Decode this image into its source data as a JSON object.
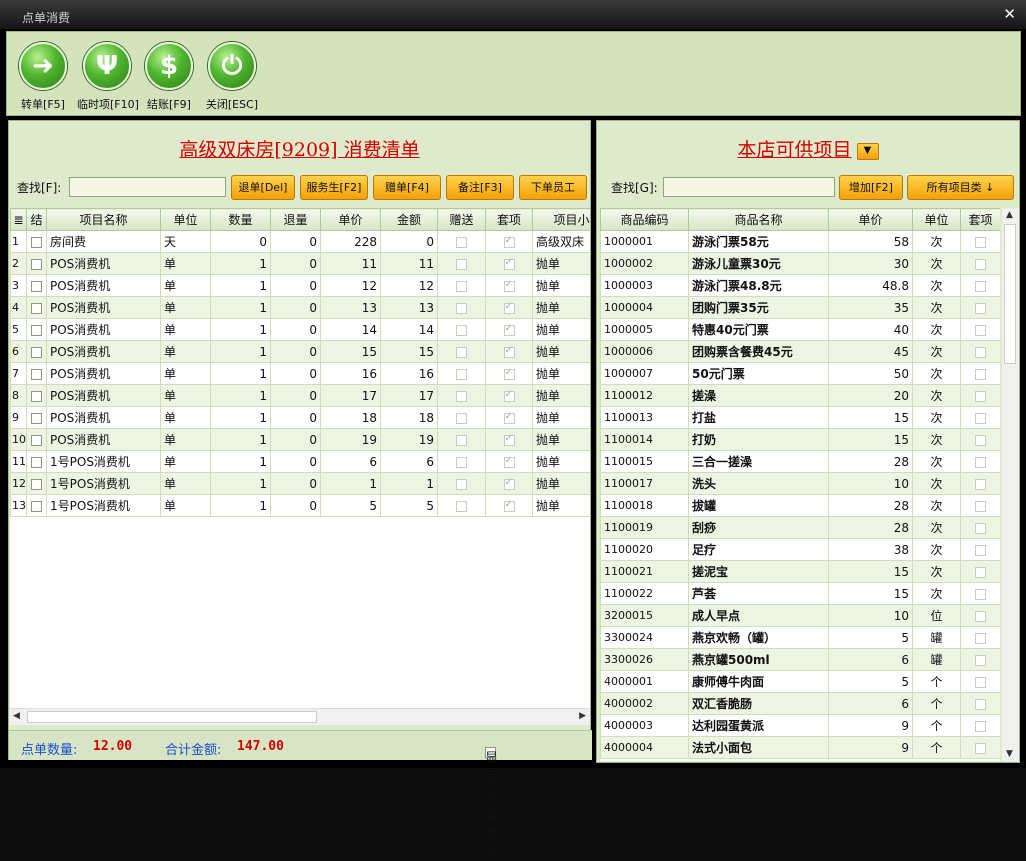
{
  "window": {
    "title": "点单消费",
    "close_icon": "close-icon"
  },
  "toolbar": {
    "buttons": [
      {
        "label": "转单[F5]",
        "icon": "transfer-arrow-icon",
        "glyph": "➜"
      },
      {
        "label": "临时项[F10]",
        "icon": "fork-knife-icon",
        "glyph": "Ψ"
      },
      {
        "label": "结账[F9]",
        "icon": "dollar-icon",
        "glyph": "$"
      },
      {
        "label": "关闭[ESC]",
        "icon": "power-icon",
        "glyph": "⏻"
      }
    ]
  },
  "left": {
    "title": "高级双床房[9209] 消费清单",
    "search_label": "查找[F]:",
    "search_value": "",
    "buttons": [
      "退单[Del]",
      "服务生[F2]",
      "赠单[F4]",
      "备注[F3]",
      "下单员工"
    ],
    "columns": [
      "结",
      "项目名称",
      "单位",
      "数量",
      "退量",
      "单价",
      "金额",
      "赠送",
      "套项",
      "项目小"
    ],
    "rows": [
      {
        "n": "1",
        "name": "房间费",
        "unit": "天",
        "qty": "0",
        "ret": "0",
        "price": "228",
        "amt": "0",
        "group": "高级双床"
      },
      {
        "n": "2",
        "name": "POS消费机",
        "unit": "单",
        "qty": "1",
        "ret": "0",
        "price": "11",
        "amt": "11",
        "group": "抛单"
      },
      {
        "n": "3",
        "name": "POS消费机",
        "unit": "单",
        "qty": "1",
        "ret": "0",
        "price": "12",
        "amt": "12",
        "group": "抛单"
      },
      {
        "n": "4",
        "name": "POS消费机",
        "unit": "单",
        "qty": "1",
        "ret": "0",
        "price": "13",
        "amt": "13",
        "group": "抛单"
      },
      {
        "n": "5",
        "name": "POS消费机",
        "unit": "单",
        "qty": "1",
        "ret": "0",
        "price": "14",
        "amt": "14",
        "group": "抛单"
      },
      {
        "n": "6",
        "name": "POS消费机",
        "unit": "单",
        "qty": "1",
        "ret": "0",
        "price": "15",
        "amt": "15",
        "group": "抛单"
      },
      {
        "n": "7",
        "name": "POS消费机",
        "unit": "单",
        "qty": "1",
        "ret": "0",
        "price": "16",
        "amt": "16",
        "group": "抛单"
      },
      {
        "n": "8",
        "name": "POS消费机",
        "unit": "单",
        "qty": "1",
        "ret": "0",
        "price": "17",
        "amt": "17",
        "group": "抛单"
      },
      {
        "n": "9",
        "name": "POS消费机",
        "unit": "单",
        "qty": "1",
        "ret": "0",
        "price": "18",
        "amt": "18",
        "group": "抛单"
      },
      {
        "n": "10",
        "name": "POS消费机",
        "unit": "单",
        "qty": "1",
        "ret": "0",
        "price": "19",
        "amt": "19",
        "group": "抛单"
      },
      {
        "n": "11",
        "name": "1号POS消费机",
        "unit": "单",
        "qty": "1",
        "ret": "0",
        "price": "6",
        "amt": "6",
        "group": "抛单"
      },
      {
        "n": "12",
        "name": "1号POS消费机",
        "unit": "单",
        "qty": "1",
        "ret": "0",
        "price": "1",
        "amt": "1",
        "group": "抛单"
      },
      {
        "n": "13",
        "name": "1号POS消费机",
        "unit": "单",
        "qty": "1",
        "ret": "0",
        "price": "5",
        "amt": "5",
        "group": "抛单"
      }
    ],
    "footer": {
      "count_label": "点单数量:",
      "count_value": "12.00",
      "total_label": "合计金额:",
      "total_value": "147.00",
      "show_category_label": "显示分类合计"
    }
  },
  "right": {
    "title": "本店可供项目",
    "search_label": "查找[G]:",
    "search_value": "",
    "add_button": "增加[F2]",
    "category_button": "所有项目类 ↓",
    "columns": [
      "商品编码",
      "商品名称",
      "单价",
      "单位",
      "套项"
    ],
    "rows": [
      {
        "code": "1000001",
        "name": "游泳门票58元",
        "price": "58",
        "unit": "次"
      },
      {
        "code": "1000002",
        "name": "游泳儿童票30元",
        "price": "30",
        "unit": "次"
      },
      {
        "code": "1000003",
        "name": "游泳门票48.8元",
        "price": "48.8",
        "unit": "次"
      },
      {
        "code": "1000004",
        "name": "团购门票35元",
        "price": "35",
        "unit": "次"
      },
      {
        "code": "1000005",
        "name": "特惠40元门票",
        "price": "40",
        "unit": "次"
      },
      {
        "code": "1000006",
        "name": "团购票含餐费45元",
        "price": "45",
        "unit": "次"
      },
      {
        "code": "1000007",
        "name": "50元门票",
        "price": "50",
        "unit": "次"
      },
      {
        "code": "1100012",
        "name": "搓澡",
        "price": "20",
        "unit": "次"
      },
      {
        "code": "1100013",
        "name": "打盐",
        "price": "15",
        "unit": "次"
      },
      {
        "code": "1100014",
        "name": "打奶",
        "price": "15",
        "unit": "次"
      },
      {
        "code": "1100015",
        "name": "三合一搓澡",
        "price": "28",
        "unit": "次"
      },
      {
        "code": "1100017",
        "name": "洗头",
        "price": "10",
        "unit": "次"
      },
      {
        "code": "1100018",
        "name": "拔罐",
        "price": "28",
        "unit": "次"
      },
      {
        "code": "1100019",
        "name": "刮痧",
        "price": "28",
        "unit": "次"
      },
      {
        "code": "1100020",
        "name": "足疗",
        "price": "38",
        "unit": "次"
      },
      {
        "code": "1100021",
        "name": "搓泥宝",
        "price": "15",
        "unit": "次"
      },
      {
        "code": "1100022",
        "name": "芦荟",
        "price": "15",
        "unit": "次"
      },
      {
        "code": "3200015",
        "name": "成人早点",
        "price": "10",
        "unit": "位"
      },
      {
        "code": "3300024",
        "name": "燕京欢畅（罐）",
        "price": "5",
        "unit": "罐"
      },
      {
        "code": "3300026",
        "name": "燕京罐500ml",
        "price": "6",
        "unit": "罐"
      },
      {
        "code": "4000001",
        "name": "康师傅牛肉面",
        "price": "5",
        "unit": "个"
      },
      {
        "code": "4000002",
        "name": "双汇香脆肠",
        "price": "6",
        "unit": "个"
      },
      {
        "code": "4000003",
        "name": "达利园蛋黄派",
        "price": "9",
        "unit": "个"
      },
      {
        "code": "4000004",
        "name": "法式小面包",
        "price": "9",
        "unit": "个"
      }
    ]
  }
}
